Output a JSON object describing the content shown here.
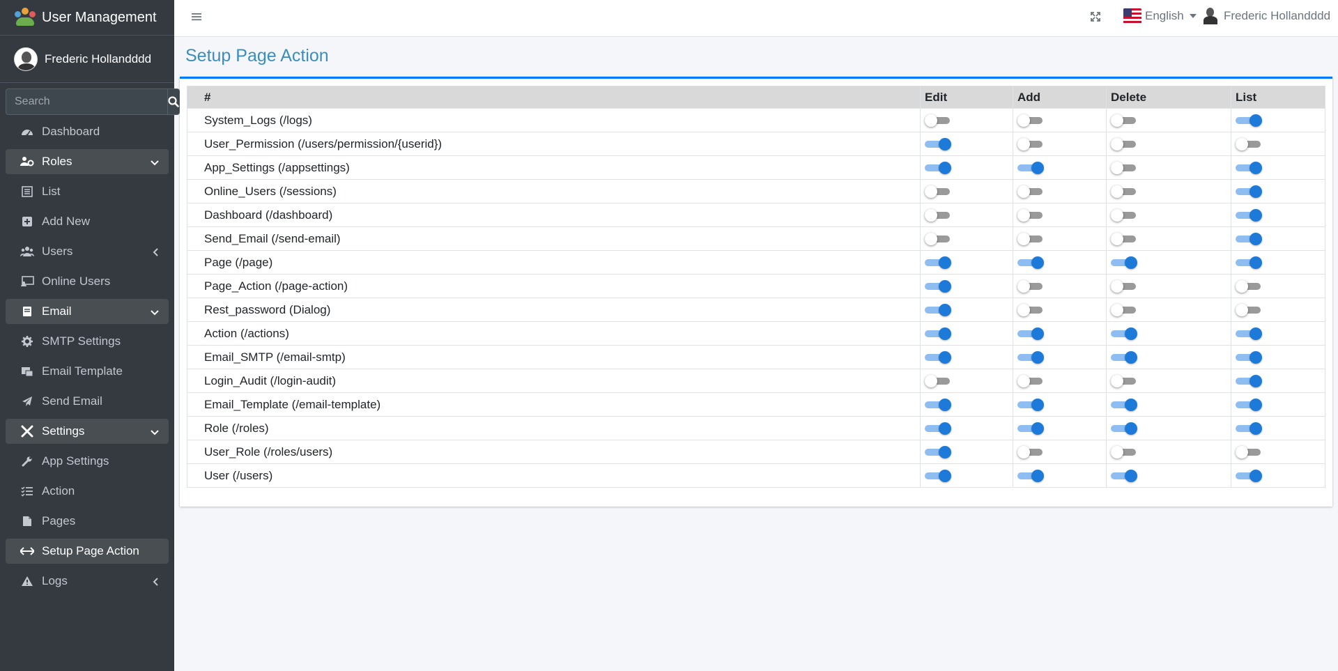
{
  "app": {
    "title": "User Management"
  },
  "user": {
    "name": "Frederic Hollandddd"
  },
  "search": {
    "placeholder": "Search"
  },
  "sidebar": {
    "items": [
      {
        "label": "Dashboard",
        "icon": "dashboard-icon",
        "type": "item"
      },
      {
        "label": "Roles",
        "icon": "users-cog-icon",
        "type": "group",
        "state": "open"
      },
      {
        "label": "List",
        "icon": "list-icon",
        "type": "sub"
      },
      {
        "label": "Add New",
        "icon": "plus-square-icon",
        "type": "sub"
      },
      {
        "label": "Users",
        "icon": "users-icon",
        "type": "group",
        "state": "collapsed"
      },
      {
        "label": "Online Users",
        "icon": "screen-user-icon",
        "type": "item"
      },
      {
        "label": "Email",
        "icon": "mail-box-icon",
        "type": "group",
        "state": "open"
      },
      {
        "label": "SMTP Settings",
        "icon": "gear-icon",
        "type": "sub"
      },
      {
        "label": "Email Template",
        "icon": "mail-template-icon",
        "type": "sub"
      },
      {
        "label": "Send Email",
        "icon": "paper-plane-icon",
        "type": "sub"
      },
      {
        "label": "Settings",
        "icon": "tools-icon",
        "type": "group",
        "state": "open"
      },
      {
        "label": "App Settings",
        "icon": "wrench-icon",
        "type": "sub"
      },
      {
        "label": "Action",
        "icon": "tasks-icon",
        "type": "sub"
      },
      {
        "label": "Pages",
        "icon": "file-icon",
        "type": "sub"
      },
      {
        "label": "Setup Page Action",
        "icon": "arrows-h-icon",
        "type": "sub",
        "state": "active"
      },
      {
        "label": "Logs",
        "icon": "warning-icon",
        "type": "group",
        "state": "collapsed"
      }
    ]
  },
  "header": {
    "language": "English",
    "user_name": "Frederic Hollandddd"
  },
  "page": {
    "title": "Setup Page Action"
  },
  "table": {
    "headers": [
      "#",
      "Edit",
      "Add",
      "Delete",
      "List"
    ],
    "rows": [
      {
        "name": "System_Logs (/logs)",
        "edit": false,
        "add": false,
        "delete": false,
        "list": true
      },
      {
        "name": "User_Permission (/users/permission/{userid})",
        "edit": true,
        "add": false,
        "delete": false,
        "list": false
      },
      {
        "name": "App_Settings (/appsettings)",
        "edit": true,
        "add": true,
        "delete": false,
        "list": true
      },
      {
        "name": "Online_Users (/sessions)",
        "edit": false,
        "add": false,
        "delete": false,
        "list": true
      },
      {
        "name": "Dashboard (/dashboard)",
        "edit": false,
        "add": false,
        "delete": false,
        "list": true
      },
      {
        "name": "Send_Email (/send-email)",
        "edit": false,
        "add": false,
        "delete": false,
        "list": true
      },
      {
        "name": "Page (/page)",
        "edit": true,
        "add": true,
        "delete": true,
        "list": true
      },
      {
        "name": "Page_Action (/page-action)",
        "edit": true,
        "add": false,
        "delete": false,
        "list": false
      },
      {
        "name": "Rest_password (Dialog)",
        "edit": true,
        "add": false,
        "delete": false,
        "list": false
      },
      {
        "name": "Action (/actions)",
        "edit": true,
        "add": true,
        "delete": true,
        "list": true
      },
      {
        "name": "Email_SMTP (/email-smtp)",
        "edit": true,
        "add": true,
        "delete": true,
        "list": true
      },
      {
        "name": "Login_Audit (/login-audit)",
        "edit": false,
        "add": false,
        "delete": false,
        "list": true
      },
      {
        "name": "Email_Template (/email-template)",
        "edit": true,
        "add": true,
        "delete": true,
        "list": true
      },
      {
        "name": "Role (/roles)",
        "edit": true,
        "add": true,
        "delete": true,
        "list": true
      },
      {
        "name": "User_Role (/roles/users)",
        "edit": true,
        "add": false,
        "delete": false,
        "list": false
      },
      {
        "name": "User (/users)",
        "edit": true,
        "add": true,
        "delete": true,
        "list": true
      }
    ]
  },
  "colors": {
    "accent": "#3c8dbc",
    "toggle_on": "#1e7ad9",
    "sidebar_bg": "#343a40"
  }
}
